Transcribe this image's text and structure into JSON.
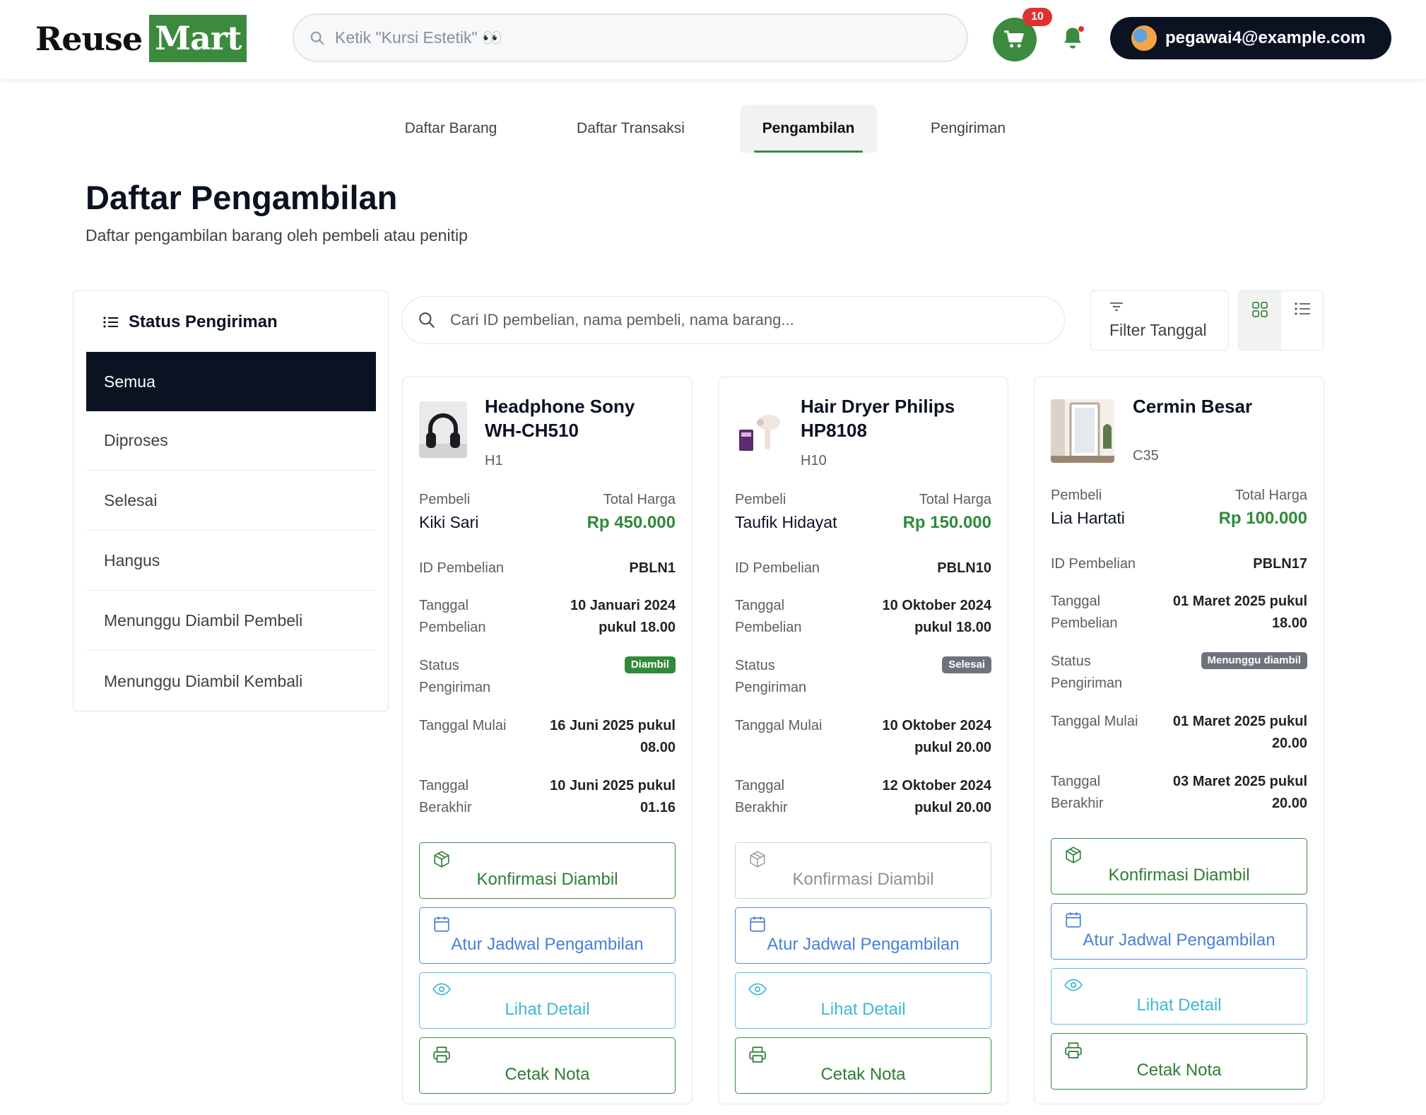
{
  "header": {
    "logo_reuse": "Reuse",
    "logo_mart": "Mart",
    "search_placeholder": "Ketik \"Kursi Estetik\" 👀",
    "cart_count": "10",
    "user_email": "pegawai4@example.com"
  },
  "tabs": [
    {
      "label": "Daftar Barang",
      "active": false
    },
    {
      "label": "Daftar Transaksi",
      "active": false
    },
    {
      "label": "Pengambilan",
      "active": true
    },
    {
      "label": "Pengiriman",
      "active": false
    }
  ],
  "page": {
    "title": "Daftar Pengambilan",
    "subtitle": "Daftar pengambilan barang oleh pembeli atau penitip"
  },
  "sidebar": {
    "title": "Status Pengiriman",
    "items": [
      {
        "label": "Semua",
        "active": true
      },
      {
        "label": "Diproses",
        "active": false
      },
      {
        "label": "Selesai",
        "active": false
      },
      {
        "label": "Hangus",
        "active": false
      },
      {
        "label": "Menunggu Diambil Pembeli",
        "active": false
      },
      {
        "label": "Menunggu Diambil Kembali",
        "active": false
      }
    ]
  },
  "toolbar": {
    "search_placeholder": "Cari ID pembelian, nama pembeli, nama barang...",
    "filter_label": "Filter Tanggal"
  },
  "labels": {
    "buyer": "Pembeli",
    "total": "Total Harga",
    "purchase_id": "ID Pembelian",
    "date_1": "Tanggal",
    "date_2": "Pembelian",
    "status_1": "Status",
    "status_2": "Pengiriman",
    "start": "Tanggal Mulai",
    "end_1": "Tanggal",
    "end_2": "Berakhir",
    "btn_confirm": "Konfirmasi Diambil",
    "btn_schedule": "Atur Jadwal Pengambilan",
    "btn_detail": "Lihat Detail",
    "btn_print": "Cetak Nota"
  },
  "cards": [
    {
      "name": "Headphone Sony WH-CH510",
      "code": "H1",
      "buyer": "Kiki Sari",
      "price": "Rp 450.000",
      "purchase_id": "PBLN1",
      "purchase_date_1": "10 Januari 2024",
      "purchase_date_2": "pukul 18.00",
      "status": "Diambil",
      "status_color": "#2f8a3a",
      "start_1": "16 Juni 2025 pukul",
      "start_2": "08.00",
      "end_1": "10 Juni 2025 pukul",
      "end_2": "01.16"
    },
    {
      "name": "Hair Dryer Philips HP8108",
      "code": "H10",
      "buyer": "Taufik Hidayat",
      "price": "Rp 150.000",
      "purchase_id": "PBLN10",
      "purchase_date_1": "10 Oktober 2024",
      "purchase_date_2": "pukul 18.00",
      "status": "Selesai",
      "status_color": "#6c737c",
      "start_1": "10 Oktober 2024",
      "start_2": "pukul 20.00",
      "end_1": "12 Oktober 2024",
      "end_2": "pukul 20.00"
    },
    {
      "name": "Cermin Besar",
      "code": "C35",
      "buyer": "Lia Hartati",
      "price": "Rp 100.000",
      "purchase_id": "PBLN17",
      "purchase_date_1": "01 Maret 2025 pukul",
      "purchase_date_2": "18.00",
      "status": "Menunggu diambil",
      "status_color": "#6c737c",
      "start_1": "01 Maret 2025 pukul",
      "start_2": "20.00",
      "end_1": "03 Maret 2025 pukul",
      "end_2": "20.00"
    }
  ]
}
